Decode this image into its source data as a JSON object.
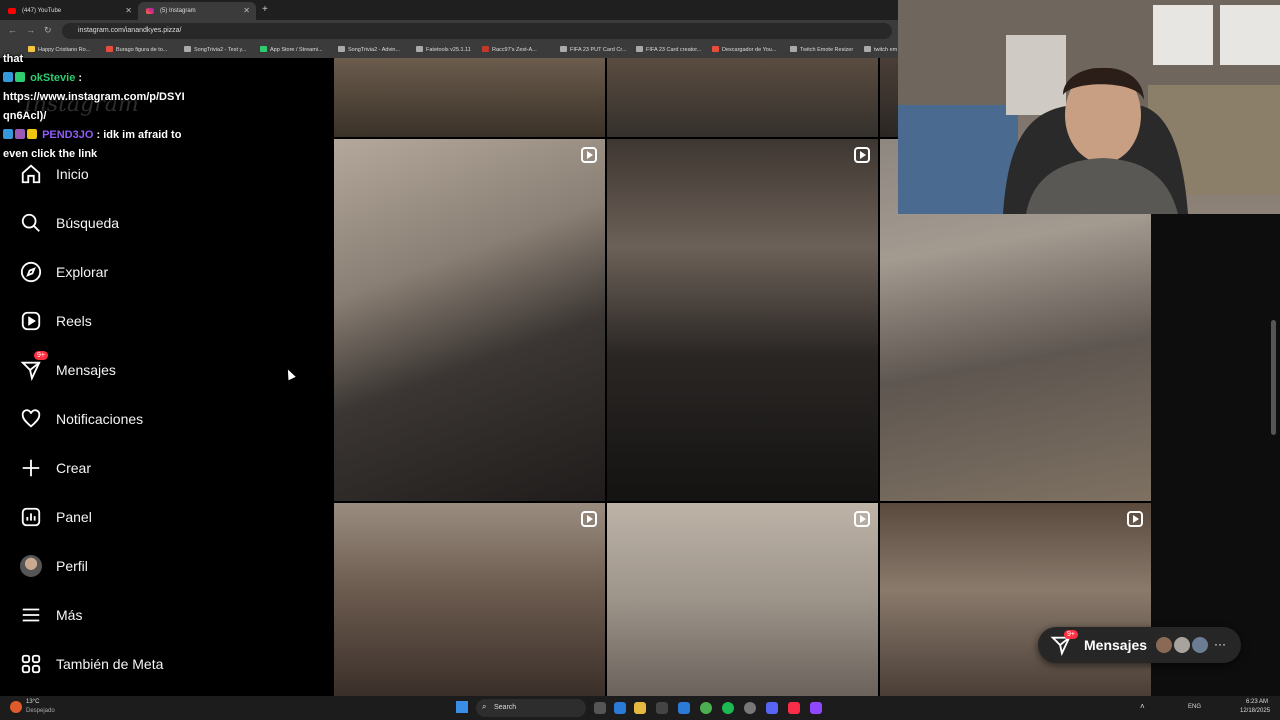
{
  "browser": {
    "tabs": [
      {
        "title": "(447) YouTube"
      },
      {
        "title": "(5) Instagram"
      }
    ],
    "url": "instagram.com/ianandkyes.pizza/",
    "bookmarks": [
      "Happy Cristiano Ro...",
      "Burago figura de to...",
      "SongTrivia2 - Test y...",
      "App Store / Streami...",
      "SongTrivia2 - Advin...",
      "Fatetools v25.1.11",
      "Racc97's Zest-A...",
      "FIFA 23 PUT Card Cr...",
      "FIFA 23 Card creator...",
      "Descargador de You...",
      "Twitch Emote Resizer",
      "twitch em"
    ]
  },
  "chat": {
    "line1_tail": "that",
    "msg1_user": "okStevie",
    "msg1_text_a": "https://www.instagram.com/p/DSYI",
    "msg1_text_b": "qn6Acl)/",
    "msg2_user": "PEND3JO",
    "msg2_text_a": "idk im afraid to",
    "msg2_text_b": "even click the link",
    "msg1_color": "#2ecc71",
    "msg2_color": "#8e5cf7"
  },
  "sidebar": {
    "logo": "Instagram",
    "items": [
      {
        "label": "Inicio",
        "icon": "home-icon"
      },
      {
        "label": "Búsqueda",
        "icon": "search-icon"
      },
      {
        "label": "Explorar",
        "icon": "compass-icon"
      },
      {
        "label": "Reels",
        "icon": "reels-icon"
      },
      {
        "label": "Mensajes",
        "icon": "messenger-icon",
        "badge": "9+"
      },
      {
        "label": "Notificaciones",
        "icon": "heart-icon"
      },
      {
        "label": "Crear",
        "icon": "plus-icon"
      },
      {
        "label": "Panel",
        "icon": "chart-icon"
      },
      {
        "label": "Perfil",
        "icon": "avatar"
      },
      {
        "label": "Más",
        "icon": "menu-icon"
      },
      {
        "label": "También de Meta",
        "icon": "meta-apps-icon"
      }
    ]
  },
  "messages_pill": {
    "label": "Mensajes",
    "badge": "9+"
  },
  "taskbar": {
    "weather_temp": "13°C",
    "weather_desc": "Despejado",
    "search": "Search",
    "lang": "ENG",
    "time": "6:23 AM",
    "date": "12/18/2025"
  },
  "colors": {
    "badge": "#ff3040",
    "background": "#000000"
  }
}
